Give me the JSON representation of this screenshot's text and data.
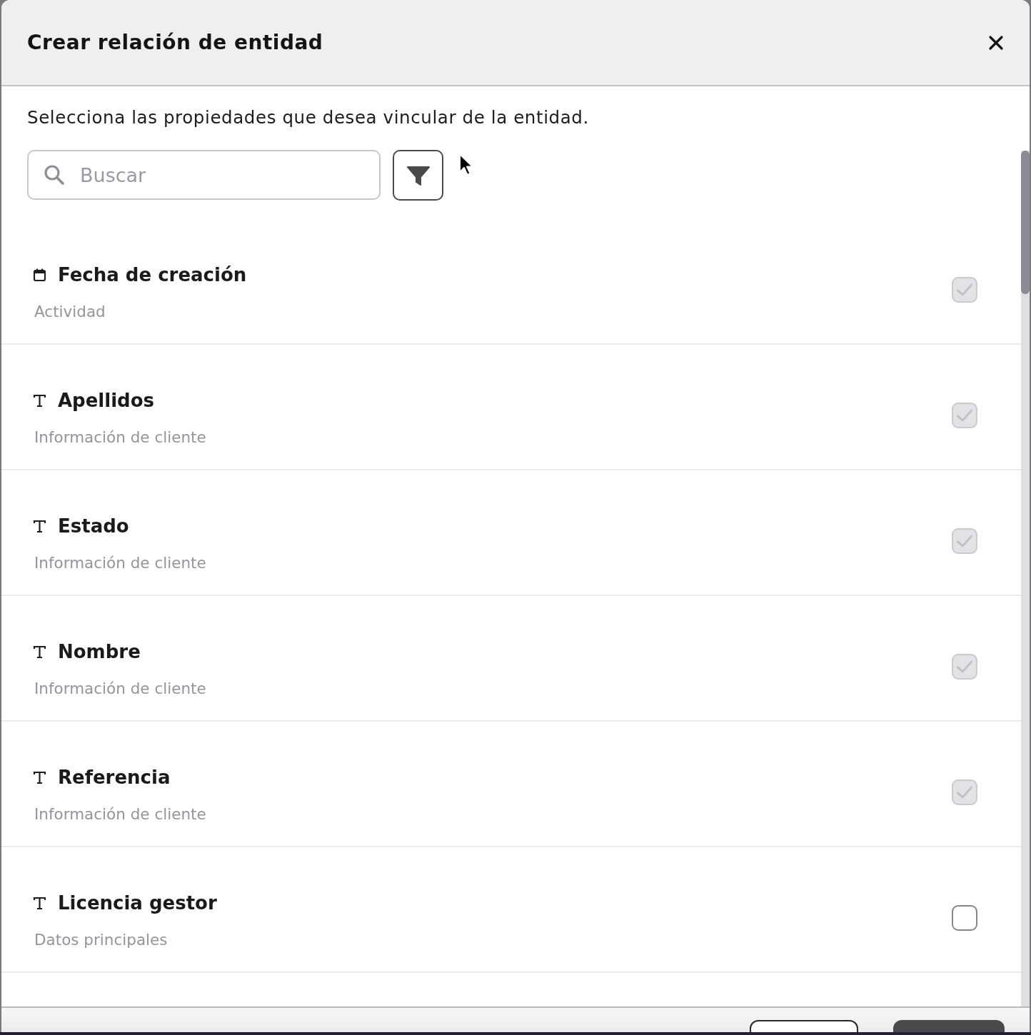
{
  "dialog": {
    "title": "Crear relación de entidad",
    "description": "Selecciona las propiedades que desea vincular de la entidad."
  },
  "search": {
    "placeholder": "Buscar"
  },
  "properties": [
    {
      "kind": "date",
      "name": "Fecha de creación",
      "group": "Actividad",
      "checked": true,
      "disabled": true
    },
    {
      "kind": "text",
      "name": "Apellidos",
      "group": "Información de cliente",
      "checked": true,
      "disabled": true
    },
    {
      "kind": "text",
      "name": "Estado",
      "group": "Información de cliente",
      "checked": true,
      "disabled": true
    },
    {
      "kind": "text",
      "name": "Nombre",
      "group": "Información de cliente",
      "checked": true,
      "disabled": true
    },
    {
      "kind": "text",
      "name": "Referencia",
      "group": "Información de cliente",
      "checked": true,
      "disabled": true
    },
    {
      "kind": "text",
      "name": "Licencia gestor",
      "group": "Datos principales",
      "checked": false,
      "disabled": false
    }
  ],
  "footer": {
    "buttons": [
      {
        "kind": "outline"
      },
      {
        "kind": "primary"
      }
    ]
  }
}
